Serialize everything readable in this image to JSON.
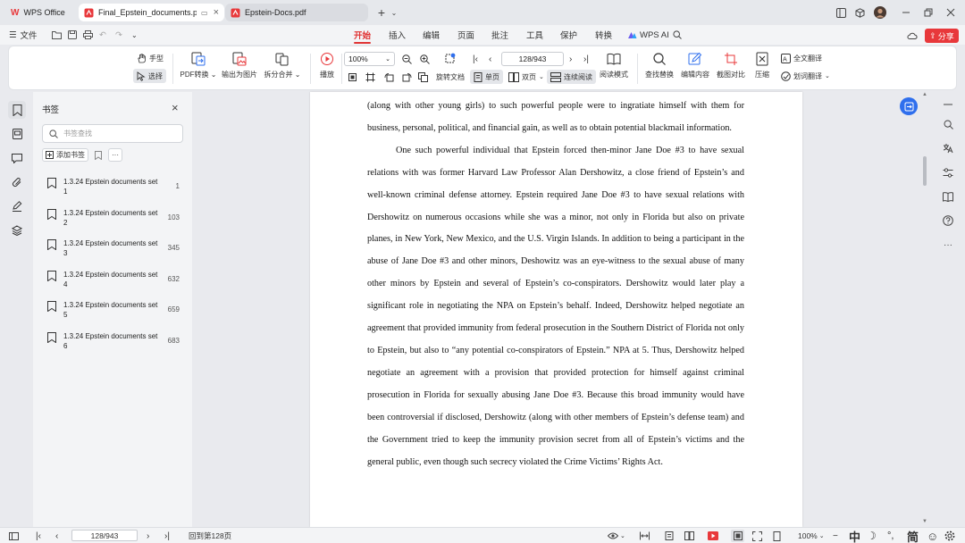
{
  "tabs": [
    {
      "label": "WPS Office"
    },
    {
      "label": "Final_Epstein_documents.pd"
    },
    {
      "label": "Epstein-Docs.pdf"
    }
  ],
  "menu": {
    "file": "文件",
    "items": [
      "开始",
      "插入",
      "编辑",
      "页面",
      "批注",
      "工具",
      "保护",
      "转换"
    ],
    "active_index": 0,
    "wps_ai": "WPS AI",
    "share": "分享"
  },
  "ribbon": {
    "hand": "手型",
    "select": "选择",
    "pdf_convert": "PDF转换",
    "export_image": "输出为图片",
    "split_merge": "拆分合并",
    "play": "播放",
    "zoom": "100%",
    "page_input": "128/943",
    "rotate": "旋转文档",
    "single_page": "单页",
    "double_page": "双页",
    "continuous": "连续阅读",
    "read_mode": "阅读模式",
    "find_replace": "查找替换",
    "edit_content": "编辑内容",
    "screenshot_compare": "截图对比",
    "compress": "压缩",
    "full_translate": "全文翻译",
    "select_translate": "划词翻译"
  },
  "bookmarks": {
    "title": "书签",
    "search_placeholder": "书签查找",
    "add": "添加书签",
    "items": [
      {
        "title": "1.3.24 Epstein documents set 1",
        "page": "1"
      },
      {
        "title": "1.3.24 Epstein documents set 2",
        "page": "103"
      },
      {
        "title": "1.3.24 Epstein documents set 3",
        "page": "345"
      },
      {
        "title": "1.3.24 Epstein documents set 4",
        "page": "632"
      },
      {
        "title": "1.3.24 Epstein documents set 5",
        "page": "659"
      },
      {
        "title": "1.3.24 Epstein documents set 6",
        "page": "683"
      }
    ]
  },
  "document": {
    "paragraphs": [
      "(along with other young girls) to such powerful people were to ingratiate himself with them for business, personal, political, and financial gain, as well as to obtain potential blackmail information.",
      "One such powerful individual that Epstein forced then-minor Jane Doe #3 to have sexual relations with was former Harvard Law Professor Alan Dershowitz, a close friend of Epstein’s and well-known criminal defense attorney.  Epstein required Jane Doe #3 to have sexual relations with Dershowitz on numerous occasions while she was a minor, not only in Florida but also on private planes, in New York, New Mexico, and the U.S. Virgin Islands.  In addition to being a participant in the abuse of Jane Doe #3 and other minors, Deshowitz was an eye-witness to the sexual abuse of many other minors by Epstein and several of Epstein’s co-conspirators.  Dershowitz would later play a significant role in negotiating the NPA on Epstein’s behalf.  Indeed, Dershowitz helped negotiate an agreement that provided immunity from federal prosecution in the Southern District of Florida not only to Epstein, but also to “any potential co-conspirators of Epstein.”  NPA at 5.  Thus, Dershowitz helped negotiate an agreement with a provision that provided protection for himself against criminal prosecution in Florida for sexually abusing Jane Doe #3.  Because this broad immunity would have been controversial if disclosed, Dershowitz (along with other members of Epstein’s defense team) and the Government tried to keep the immunity provision secret from all of Epstein’s victims and the general public, even though such secrecy violated the Crime Victims’ Rights Act."
    ]
  },
  "status": {
    "page_input": "128/943",
    "goto_text": "回到第128页",
    "zoom": "100%",
    "ime": [
      "中",
      "简"
    ]
  },
  "colors": {
    "accent": "#e03434",
    "share_bg": "#e8383b",
    "float_button": "#2f6fed"
  }
}
